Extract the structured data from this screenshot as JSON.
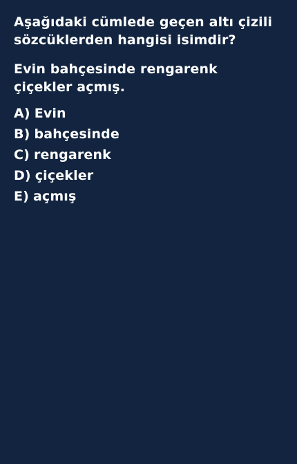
{
  "question": {
    "line1": "Aşağıdaki cümlede geçen altı çizili",
    "line2": "sözcüklerden hangisi isimdir?"
  },
  "sentence": {
    "line1": "Evin bahçesinde rengarenk",
    "line2": "çiçekler açmış."
  },
  "options": [
    {
      "letter": "A)",
      "text": "Evin"
    },
    {
      "letter": "B)",
      "text": "bahçesinde"
    },
    {
      "letter": "C)",
      "text": "rengarenk"
    },
    {
      "letter": "D)",
      "text": "çiçekler"
    },
    {
      "letter": "E)",
      "text": "açmış"
    }
  ],
  "colors": {
    "background": "#12243f",
    "text": "#ffffff"
  }
}
